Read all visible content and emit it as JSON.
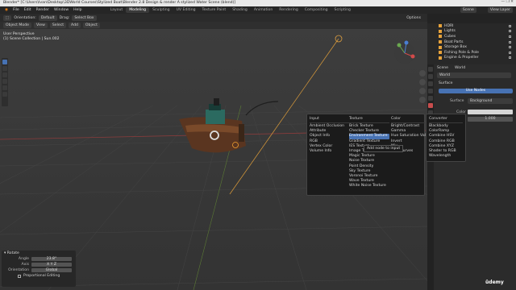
{
  "titlebar": {
    "text": "Blender* [C:\\Users\\Ivan\\Desktop\\3DWorld Courses\\Stylized Boat\\Blender 2.8 Design & render A stylized Water Scene (blend)]",
    "controls": "— ❐ ✕"
  },
  "menubar": {
    "menus": [
      "File",
      "Edit",
      "Render",
      "Window",
      "Help"
    ],
    "workspaces": [
      "Layout",
      "Modeling",
      "Sculpting",
      "UV Editing",
      "Texture Paint",
      "Shading",
      "Animation",
      "Rendering",
      "Compositing",
      "Scripting"
    ],
    "active_workspace": "Modeling",
    "scene_label": "Scene",
    "view_layer_label": "View Layer"
  },
  "toolbar": {
    "orientation_label": "Orientation:",
    "orientation_value": "Default",
    "drag_label": "Drag:",
    "drag_value": "Select Box",
    "options_label": "Options"
  },
  "header2": {
    "mode": "Object Mode",
    "menus": [
      "View",
      "Select",
      "Add",
      "Object"
    ]
  },
  "viewport": {
    "info_line1": "User Perspective",
    "info_line2": "(1) Scene Collection | Sun.002"
  },
  "outliner": {
    "items": [
      "HDRI",
      "Lights",
      "Cubes",
      "Boat Parts",
      "Storage Box",
      "Fishing Pole & Pole",
      "Engine & Propeller"
    ]
  },
  "properties": {
    "tabs": [
      "Scene",
      "World"
    ],
    "world_name": "World",
    "surface_label": "Surface",
    "use_nodes_label": "Use Nodes",
    "surface_field_label": "Surface",
    "surface_value": "Background",
    "color_label": "Color",
    "strength_label": "Strength",
    "strength_value": "1.000"
  },
  "add_menu": {
    "columns": [
      {
        "head": "Input",
        "items": [
          "Ambient Occlusion",
          "Attribute",
          "Object Info",
          "RGB",
          "Vertex Color",
          "Volume Info"
        ]
      },
      {
        "head": "Texture",
        "items": [
          "Brick Texture",
          "Checker Texture",
          "Environment Texture",
          "Gradient Texture",
          "IES Texture",
          "Image Texture",
          "Magic Texture",
          "Noise Texture",
          "Point Density",
          "Sky Texture",
          "Voronoi Texture",
          "Wave Texture",
          "White Noise Texture"
        ],
        "selected": 2
      },
      {
        "head": "Color",
        "items": [
          "Bright/Contrast",
          "Gamma",
          "Hue Saturation Value",
          "Invert",
          "Mix",
          "RGB Curves"
        ]
      },
      {
        "head": "Converter",
        "items": [
          "Blackbody",
          "ColorRamp",
          "Combine HSV",
          "Combine RGB",
          "Combine XYZ",
          "Shader to RGB",
          "Wavelength"
        ]
      }
    ],
    "tooltip": "Add node to input"
  },
  "redo_panel": {
    "title": "Rotate",
    "angle_label": "Angle",
    "angle_value": "23.8°",
    "axis_label": "Axis",
    "axis_value": "X   Y   Z",
    "orientation_label": "Orientation",
    "orientation_value": "Global",
    "proportional_label": "Proportional Editing"
  },
  "watermark": "ûdemy",
  "colors": {
    "accent": "#4772b3",
    "light_orange": "#e8a33b",
    "viewport_bg": "#393939"
  }
}
